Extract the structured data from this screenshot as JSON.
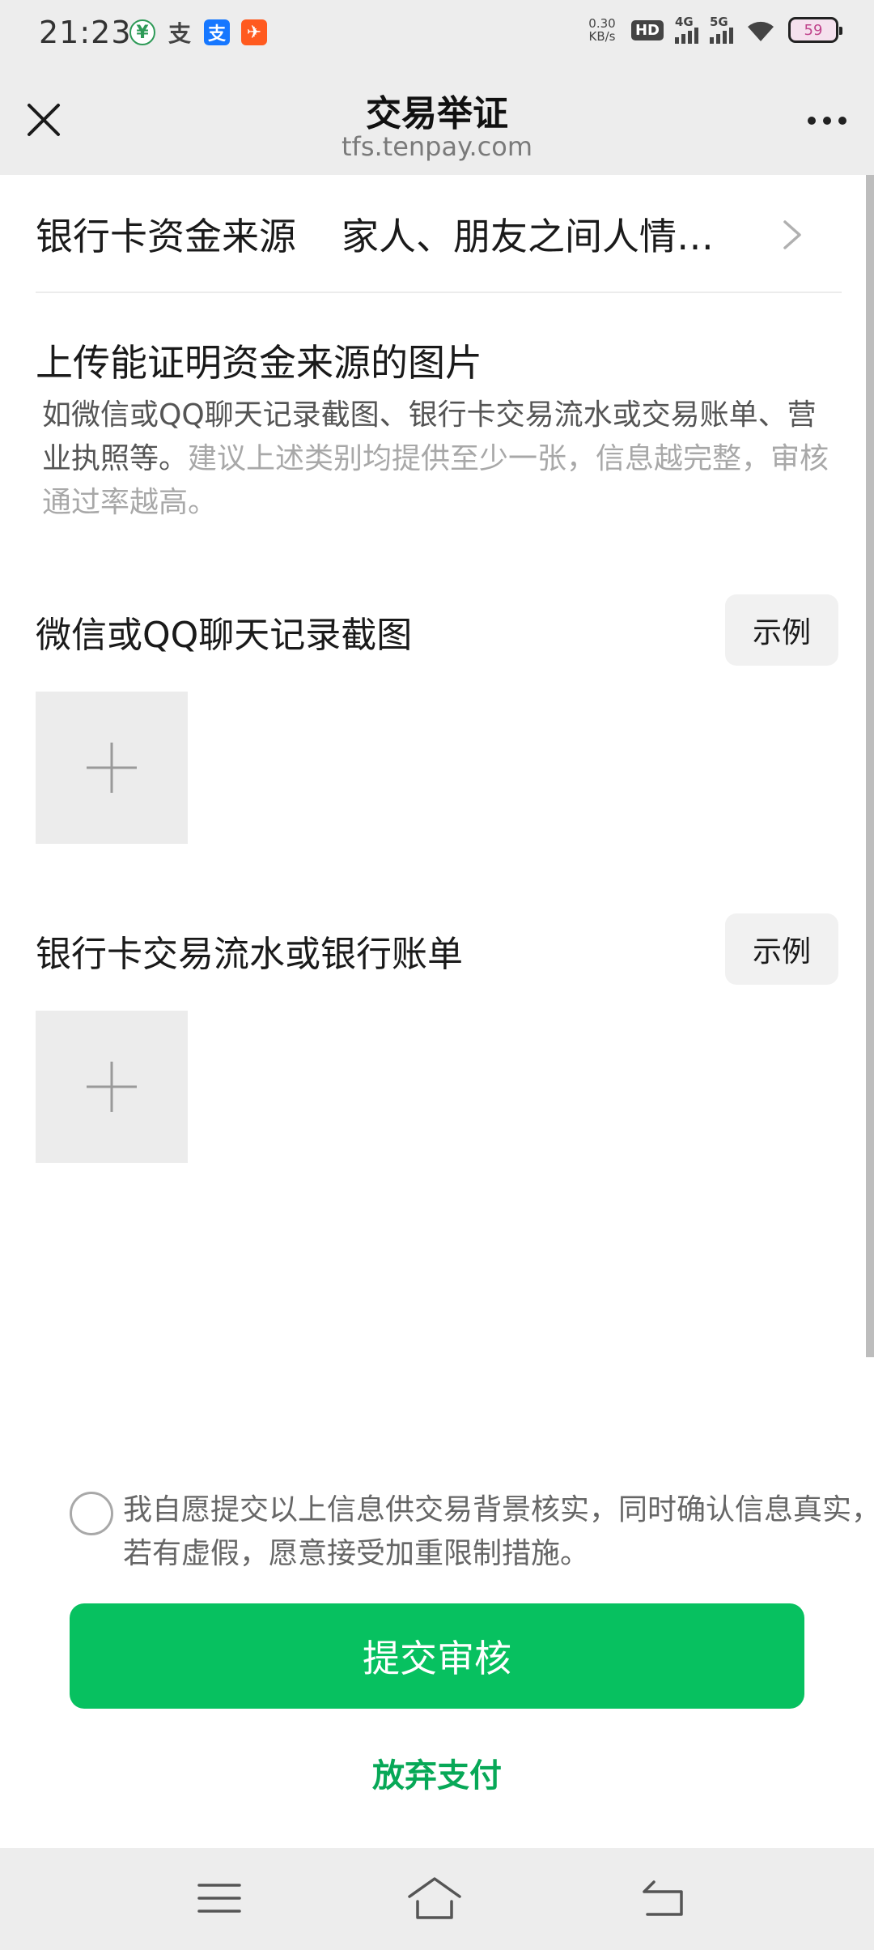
{
  "status_bar": {
    "time": "21:23",
    "notifications": [
      {
        "icon": "wechat-pay-icon",
        "glyph": "¥"
      },
      {
        "icon": "alipay-outline-icon",
        "glyph": "支"
      },
      {
        "icon": "alipay-icon",
        "glyph": "支"
      },
      {
        "icon": "message-app-icon",
        "glyph": "✈"
      }
    ],
    "net_speed_value": "0.30",
    "net_speed_unit": "KB/s",
    "hd_label": "HD",
    "signal_4g": "4G",
    "signal_5g": "5G",
    "battery": "59"
  },
  "header": {
    "title": "交易举证",
    "url": "tfs.tenpay.com"
  },
  "source_row": {
    "label": "银行卡资金来源",
    "value": "家人、朋友之间人情…"
  },
  "upload": {
    "title": "上传能证明资金来源的图片",
    "desc": "如微信或QQ聊天记录截图、银行卡交易流水或交易账单、营业执照等。",
    "hint": "建议上述类别均提供至少一张，信息越完整，审核通过率越高。"
  },
  "categories": [
    {
      "label": "微信或QQ聊天记录截图",
      "example_label": "示例"
    },
    {
      "label": "银行卡交易流水或银行账单",
      "example_label": "示例"
    }
  ],
  "agreement": {
    "text": "我自愿提交以上信息供交易背景核实，同时确认信息真实，若有虚假，愿意接受加重限制措施。"
  },
  "actions": {
    "submit_label": "提交审核",
    "abandon_label": "放弃支付"
  },
  "colors": {
    "accent": "#07c160",
    "link_green": "#07a857",
    "header_bg": "#ededed"
  }
}
